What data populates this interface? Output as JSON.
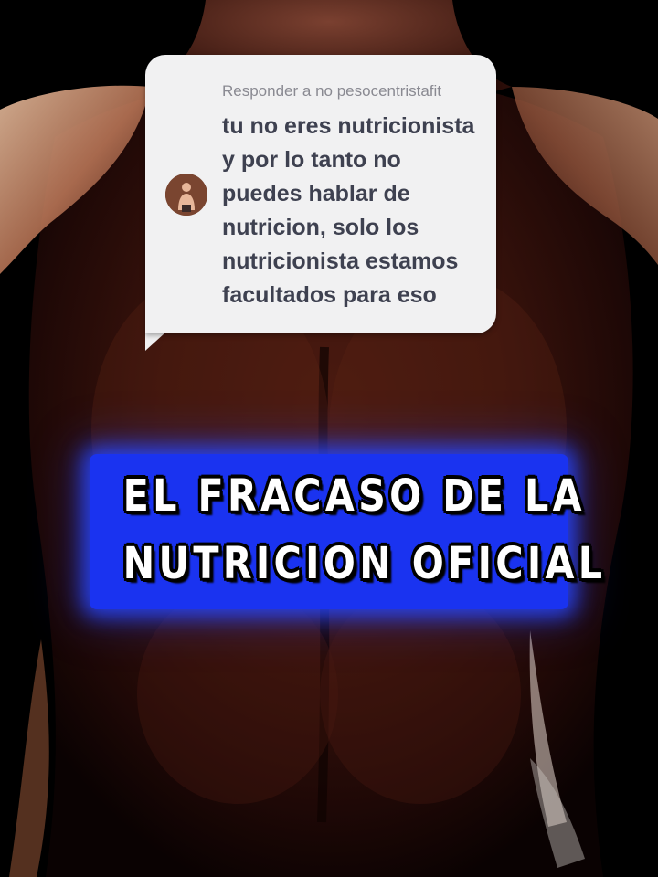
{
  "reply": {
    "header": "Responder a no pesocentristafit",
    "lines": [
      "tu no eres nutricionista",
      "y por lo tanto no",
      "puedes hablar de",
      "nutricion, solo los",
      "nutricionista estamos",
      "facultados para eso"
    ]
  },
  "title": {
    "line1": "EL FRACASO DE LA",
    "line2": "NUTRICION OFICIAL"
  },
  "colors": {
    "title_bg": "#1a33f0",
    "card_bg": "#f1f1f2",
    "reply_text": "#3e4150"
  },
  "icons": {
    "avatar": "user-avatar-shirtless-man"
  }
}
